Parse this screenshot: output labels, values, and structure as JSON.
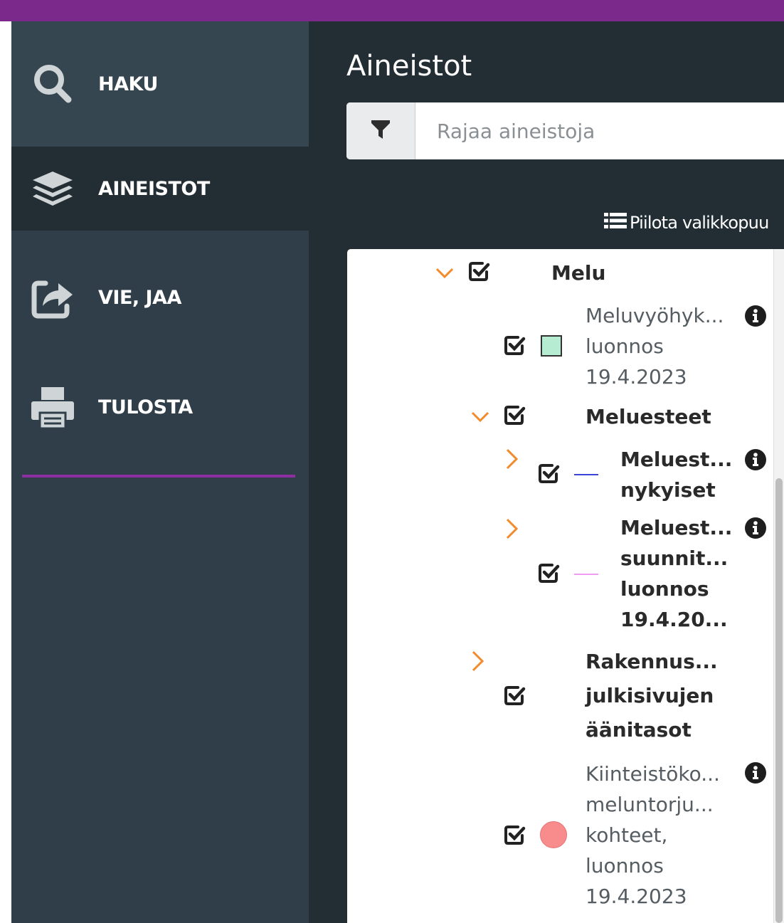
{
  "sidebar": {
    "items": [
      {
        "label": "HAKU",
        "icon": "search-icon"
      },
      {
        "label": "AINEISTOT",
        "icon": "layers-icon"
      },
      {
        "label": "VIE, JAA",
        "icon": "share-icon"
      },
      {
        "label": "TULOSTA",
        "icon": "print-icon"
      }
    ]
  },
  "panel": {
    "title": "Aineistot",
    "filter": {
      "placeholder": "Rajaa aineistoja",
      "value": "",
      "icon": "filter-icon"
    },
    "hide_tree_label": "Piilota valikkopuu",
    "hide_tree_icon": "list-icon"
  },
  "tree": {
    "melu": {
      "label": "Melu",
      "expanded": true,
      "checked": true
    },
    "meluvyohyke": {
      "lines": [
        "Meluvyöhyk...",
        "luonnos",
        "19.4.2023"
      ],
      "checked": true,
      "swatch_color": "#b5ecd2"
    },
    "meluesteet": {
      "label": "Meluesteet",
      "expanded": true,
      "checked": true
    },
    "meluesteet_nykyiset": {
      "lines": [
        "Meluest...",
        "nykyiset"
      ],
      "checked": true,
      "swatch_color": "#3b44d8"
    },
    "meluesteet_suunnitellut": {
      "lines": [
        "Meluest...",
        "suunnit...",
        "luonnos",
        "19.4.20..."
      ],
      "checked": true,
      "swatch_color": "#f19bf5"
    },
    "rakennus": {
      "lines": [
        "Rakennus...",
        "julkisivujen",
        "äänitasot"
      ],
      "checked": true
    },
    "kiinteistokohteet": {
      "lines": [
        "Kiinteistöko...",
        "meluntorju...",
        "kohteet,",
        "luonnos",
        "19.4.2023"
      ],
      "checked": true,
      "swatch_color": "#f88c8c"
    }
  },
  "colors": {
    "topbar": "#7b2a8c",
    "sidebar": "#2f3e48",
    "sidebar_active": "#222d34",
    "accent_divider": "#8d2fa0",
    "chevron": "#f28b2c"
  }
}
